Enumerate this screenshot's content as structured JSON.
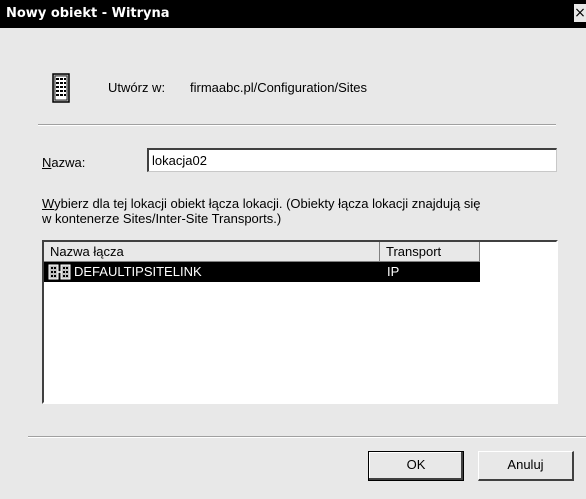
{
  "window": {
    "title": "Nowy obiekt - Witryna",
    "close_glyph": "×"
  },
  "header": {
    "create_label": "Utwórz w:",
    "create_path": "firmaabc.pl/Configuration/Sites",
    "icon": "building-icon"
  },
  "form": {
    "name_label_accel": "N",
    "name_label_rest": "azwa:",
    "name_value": "lokacja02",
    "instruction_accel": "W",
    "instruction_rest": "ybierz dla tej lokacji obiekt łącza lokacji. (Obiekty łącza lokacji znajdują się w kontenerze Sites/Inter-Site Transports.)"
  },
  "listview": {
    "columns": [
      "Nazwa łącza",
      "Transport"
    ],
    "rows": [
      {
        "name": "DEFAULTIPSITELINK",
        "transport": "IP",
        "selected": true,
        "icon": "site-link-icon"
      }
    ]
  },
  "buttons": {
    "ok_label": "OK",
    "cancel_label": "Anuluj"
  },
  "colors": {
    "titlebar": "#000000",
    "dialog_bg": "#e8e8e8",
    "selection": "#000000"
  }
}
